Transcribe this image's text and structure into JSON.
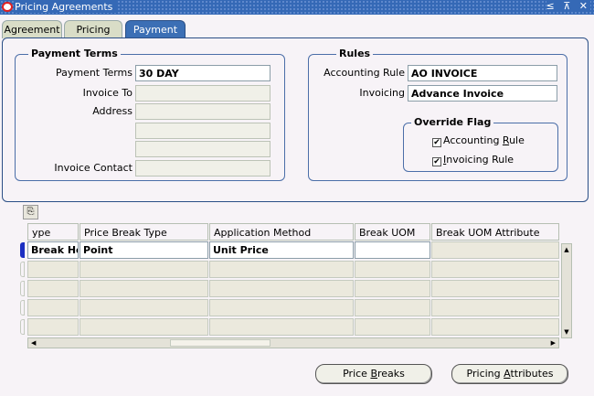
{
  "window": {
    "title": "Pricing Agreements",
    "controls": "≤ ⊼ ✕"
  },
  "tabs": [
    {
      "label": "Agreement"
    },
    {
      "label": "Pricing"
    },
    {
      "label": "Payment"
    }
  ],
  "payment_terms": {
    "title": "Payment Terms",
    "payment_terms_label": "Payment Terms",
    "payment_terms_value": "30 DAY",
    "invoice_to_label": "Invoice To",
    "invoice_to_value": "",
    "address_label": "Address",
    "invoice_contact_label": "Invoice Contact",
    "invoice_contact_value": ""
  },
  "rules": {
    "title": "Rules",
    "accounting_rule_label": "Accounting Rule",
    "accounting_rule_value": "AO INVOICE",
    "invoicing_label": "Invoicing",
    "invoicing_value": "Advance Invoice",
    "override_flag": {
      "title": "Override Flag",
      "accounting_rule_label_pre": "Accounting ",
      "accounting_rule_label_key": "R",
      "accounting_rule_label_post": "ule",
      "accounting_rule_checked": true,
      "invoicing_rule_label_key": "I",
      "invoicing_rule_label_post": "nvoicing Rule",
      "invoicing_rule_checked": true
    }
  },
  "table": {
    "columns": [
      "ype",
      "Price Break Type",
      "Application Method",
      "Break UOM",
      "Break UOM Attribute"
    ],
    "rows": [
      {
        "type": "Break He",
        "price_break_type": "Point",
        "application_method": "Unit Price",
        "break_uom": "",
        "break_uom_attribute": ""
      }
    ]
  },
  "buttons": {
    "price_breaks_pre": "Price ",
    "price_breaks_key": "B",
    "price_breaks_post": "reaks",
    "pricing_attributes_pre": "Pricing ",
    "pricing_attributes_key": "A",
    "pricing_attributes_post": "ttributes"
  },
  "colors": {
    "titlebar": "#3569b6",
    "active_tab": "#3c6fb5",
    "row_indicator": "#1c2fc2"
  }
}
